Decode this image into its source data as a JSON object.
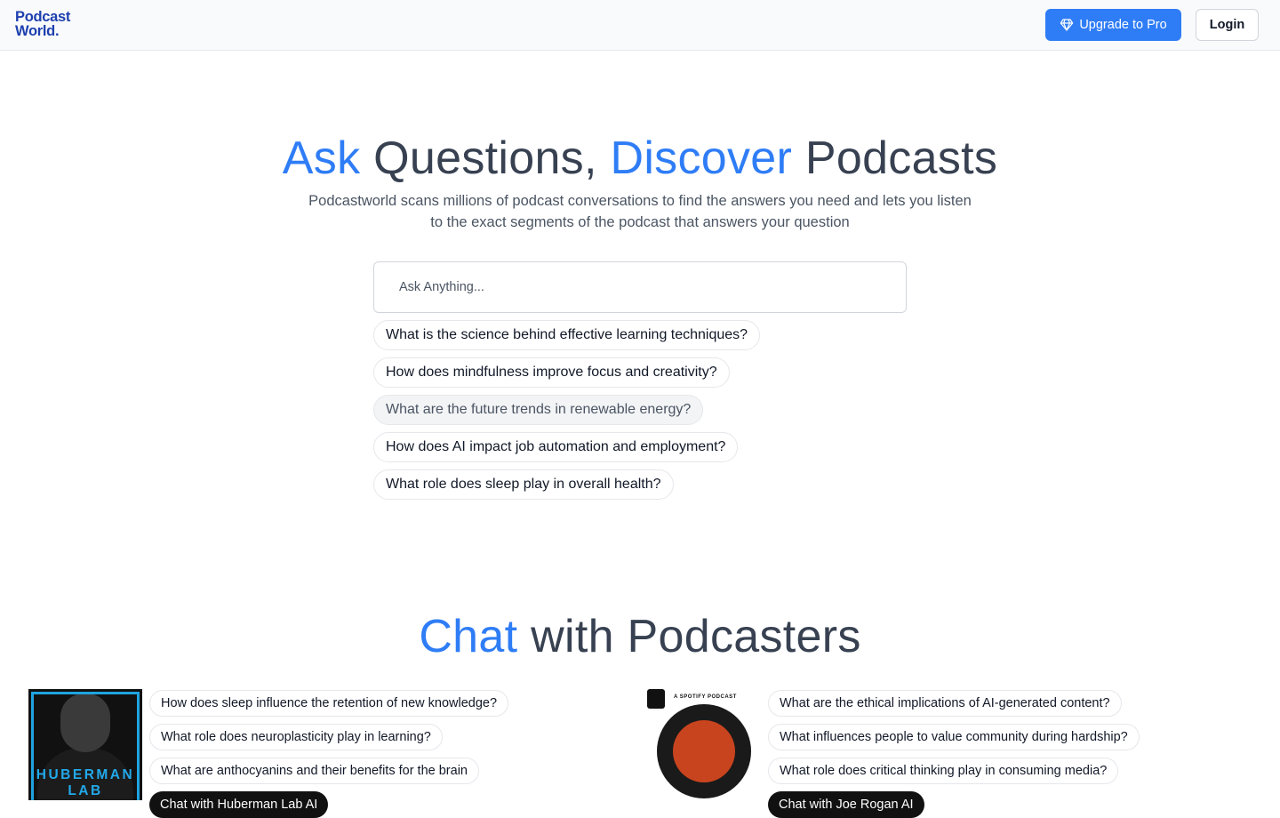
{
  "brand": {
    "logo_line1": "Podcast",
    "logo_line2": "World.",
    "color": "#1e40af"
  },
  "header": {
    "upgrade_label": "Upgrade to Pro",
    "upgrade_icon": "diamond-icon",
    "login_label": "Login",
    "accent_color": "#2f7df6"
  },
  "hero": {
    "title_word1": "Ask",
    "title_word2": " Questions, ",
    "title_word3": "Discover",
    "title_word4": " Podcasts",
    "subtitle": "Podcastworld scans millions of podcast conversations to find the answers you need and lets you listen to the exact segments of the podcast that answers your question"
  },
  "search": {
    "placeholder": "Ask Anything...",
    "value": ""
  },
  "suggestions": [
    "What is the science behind effective learning techniques?",
    "How does mindfulness improve focus and creativity?",
    "What are the future trends in renewable energy?",
    "How does AI impact job automation and employment?",
    "What role does sleep play in overall health?"
  ],
  "podcasters_section": {
    "title_word1": "Chat",
    "title_word2": " with Podcasters"
  },
  "podcasters": [
    {
      "cover_text_line1": "HUBERMAN",
      "cover_text_line2": "LAB",
      "questions": [
        "How does sleep influence the retention of new knowledge?",
        "What role does neuroplasticity play in learning?",
        "What are anthocyanins and their benefits for the brain"
      ],
      "cta": "Chat with Huberman Lab AI"
    },
    {
      "cover_badge": "A SPOTIFY PODCAST",
      "questions": [
        "What are the ethical implications of AI-generated content?",
        "What influences people to value community during hardship?",
        "What role does critical thinking play in consuming media?"
      ],
      "cta": "Chat with Joe Rogan AI"
    }
  ]
}
